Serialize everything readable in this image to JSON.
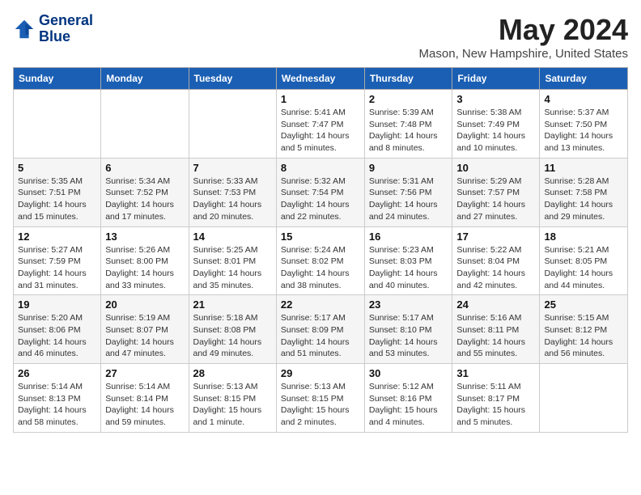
{
  "header": {
    "logo_line1": "General",
    "logo_line2": "Blue",
    "month_title": "May 2024",
    "location": "Mason, New Hampshire, United States"
  },
  "weekdays": [
    "Sunday",
    "Monday",
    "Tuesday",
    "Wednesday",
    "Thursday",
    "Friday",
    "Saturday"
  ],
  "weeks": [
    [
      {
        "day": "",
        "sunrise": "",
        "sunset": "",
        "daylight": ""
      },
      {
        "day": "",
        "sunrise": "",
        "sunset": "",
        "daylight": ""
      },
      {
        "day": "",
        "sunrise": "",
        "sunset": "",
        "daylight": ""
      },
      {
        "day": "1",
        "sunrise": "Sunrise: 5:41 AM",
        "sunset": "Sunset: 7:47 PM",
        "daylight": "Daylight: 14 hours and 5 minutes."
      },
      {
        "day": "2",
        "sunrise": "Sunrise: 5:39 AM",
        "sunset": "Sunset: 7:48 PM",
        "daylight": "Daylight: 14 hours and 8 minutes."
      },
      {
        "day": "3",
        "sunrise": "Sunrise: 5:38 AM",
        "sunset": "Sunset: 7:49 PM",
        "daylight": "Daylight: 14 hours and 10 minutes."
      },
      {
        "day": "4",
        "sunrise": "Sunrise: 5:37 AM",
        "sunset": "Sunset: 7:50 PM",
        "daylight": "Daylight: 14 hours and 13 minutes."
      }
    ],
    [
      {
        "day": "5",
        "sunrise": "Sunrise: 5:35 AM",
        "sunset": "Sunset: 7:51 PM",
        "daylight": "Daylight: 14 hours and 15 minutes."
      },
      {
        "day": "6",
        "sunrise": "Sunrise: 5:34 AM",
        "sunset": "Sunset: 7:52 PM",
        "daylight": "Daylight: 14 hours and 17 minutes."
      },
      {
        "day": "7",
        "sunrise": "Sunrise: 5:33 AM",
        "sunset": "Sunset: 7:53 PM",
        "daylight": "Daylight: 14 hours and 20 minutes."
      },
      {
        "day": "8",
        "sunrise": "Sunrise: 5:32 AM",
        "sunset": "Sunset: 7:54 PM",
        "daylight": "Daylight: 14 hours and 22 minutes."
      },
      {
        "day": "9",
        "sunrise": "Sunrise: 5:31 AM",
        "sunset": "Sunset: 7:56 PM",
        "daylight": "Daylight: 14 hours and 24 minutes."
      },
      {
        "day": "10",
        "sunrise": "Sunrise: 5:29 AM",
        "sunset": "Sunset: 7:57 PM",
        "daylight": "Daylight: 14 hours and 27 minutes."
      },
      {
        "day": "11",
        "sunrise": "Sunrise: 5:28 AM",
        "sunset": "Sunset: 7:58 PM",
        "daylight": "Daylight: 14 hours and 29 minutes."
      }
    ],
    [
      {
        "day": "12",
        "sunrise": "Sunrise: 5:27 AM",
        "sunset": "Sunset: 7:59 PM",
        "daylight": "Daylight: 14 hours and 31 minutes."
      },
      {
        "day": "13",
        "sunrise": "Sunrise: 5:26 AM",
        "sunset": "Sunset: 8:00 PM",
        "daylight": "Daylight: 14 hours and 33 minutes."
      },
      {
        "day": "14",
        "sunrise": "Sunrise: 5:25 AM",
        "sunset": "Sunset: 8:01 PM",
        "daylight": "Daylight: 14 hours and 35 minutes."
      },
      {
        "day": "15",
        "sunrise": "Sunrise: 5:24 AM",
        "sunset": "Sunset: 8:02 PM",
        "daylight": "Daylight: 14 hours and 38 minutes."
      },
      {
        "day": "16",
        "sunrise": "Sunrise: 5:23 AM",
        "sunset": "Sunset: 8:03 PM",
        "daylight": "Daylight: 14 hours and 40 minutes."
      },
      {
        "day": "17",
        "sunrise": "Sunrise: 5:22 AM",
        "sunset": "Sunset: 8:04 PM",
        "daylight": "Daylight: 14 hours and 42 minutes."
      },
      {
        "day": "18",
        "sunrise": "Sunrise: 5:21 AM",
        "sunset": "Sunset: 8:05 PM",
        "daylight": "Daylight: 14 hours and 44 minutes."
      }
    ],
    [
      {
        "day": "19",
        "sunrise": "Sunrise: 5:20 AM",
        "sunset": "Sunset: 8:06 PM",
        "daylight": "Daylight: 14 hours and 46 minutes."
      },
      {
        "day": "20",
        "sunrise": "Sunrise: 5:19 AM",
        "sunset": "Sunset: 8:07 PM",
        "daylight": "Daylight: 14 hours and 47 minutes."
      },
      {
        "day": "21",
        "sunrise": "Sunrise: 5:18 AM",
        "sunset": "Sunset: 8:08 PM",
        "daylight": "Daylight: 14 hours and 49 minutes."
      },
      {
        "day": "22",
        "sunrise": "Sunrise: 5:17 AM",
        "sunset": "Sunset: 8:09 PM",
        "daylight": "Daylight: 14 hours and 51 minutes."
      },
      {
        "day": "23",
        "sunrise": "Sunrise: 5:17 AM",
        "sunset": "Sunset: 8:10 PM",
        "daylight": "Daylight: 14 hours and 53 minutes."
      },
      {
        "day": "24",
        "sunrise": "Sunrise: 5:16 AM",
        "sunset": "Sunset: 8:11 PM",
        "daylight": "Daylight: 14 hours and 55 minutes."
      },
      {
        "day": "25",
        "sunrise": "Sunrise: 5:15 AM",
        "sunset": "Sunset: 8:12 PM",
        "daylight": "Daylight: 14 hours and 56 minutes."
      }
    ],
    [
      {
        "day": "26",
        "sunrise": "Sunrise: 5:14 AM",
        "sunset": "Sunset: 8:13 PM",
        "daylight": "Daylight: 14 hours and 58 minutes."
      },
      {
        "day": "27",
        "sunrise": "Sunrise: 5:14 AM",
        "sunset": "Sunset: 8:14 PM",
        "daylight": "Daylight: 14 hours and 59 minutes."
      },
      {
        "day": "28",
        "sunrise": "Sunrise: 5:13 AM",
        "sunset": "Sunset: 8:15 PM",
        "daylight": "Daylight: 15 hours and 1 minute."
      },
      {
        "day": "29",
        "sunrise": "Sunrise: 5:13 AM",
        "sunset": "Sunset: 8:15 PM",
        "daylight": "Daylight: 15 hours and 2 minutes."
      },
      {
        "day": "30",
        "sunrise": "Sunrise: 5:12 AM",
        "sunset": "Sunset: 8:16 PM",
        "daylight": "Daylight: 15 hours and 4 minutes."
      },
      {
        "day": "31",
        "sunrise": "Sunrise: 5:11 AM",
        "sunset": "Sunset: 8:17 PM",
        "daylight": "Daylight: 15 hours and 5 minutes."
      },
      {
        "day": "",
        "sunrise": "",
        "sunset": "",
        "daylight": ""
      }
    ]
  ]
}
